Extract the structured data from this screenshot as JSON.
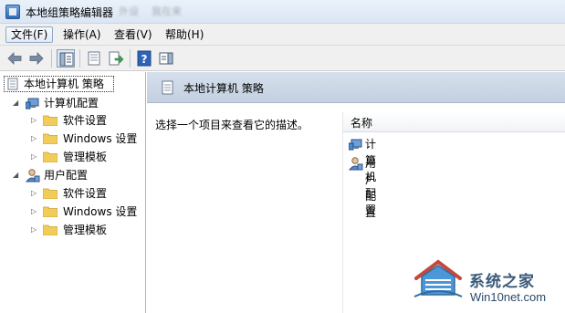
{
  "window": {
    "title": "本地组策略编辑器",
    "app_icon": "policy-editor-icon"
  },
  "background_tabs": [
    "外设",
    "我在来"
  ],
  "menubar": {
    "items": [
      {
        "label": "文件(F)",
        "active": true
      },
      {
        "label": "操作(A)"
      },
      {
        "label": "查看(V)"
      },
      {
        "label": "帮助(H)"
      }
    ]
  },
  "toolbar": {
    "buttons": [
      "back-arrow-icon",
      "forward-arrow-icon",
      "show-hide-console-tree-icon",
      "properties-icon",
      "export-list-icon",
      "help-icon",
      "action-pane-icon"
    ]
  },
  "tree": {
    "root": "本地计算机 策略",
    "computer": {
      "label": "计算机配置",
      "children": [
        "软件设置",
        "Windows 设置",
        "管理模板"
      ]
    },
    "user": {
      "label": "用户配置",
      "children": [
        "软件设置",
        "Windows 设置",
        "管理模板"
      ]
    }
  },
  "detail": {
    "header": "本地计算机 策略",
    "description": "选择一个项目来查看它的描述。",
    "column_name": "名称",
    "items": [
      "计算机配置",
      "用户配置"
    ]
  },
  "watermark": {
    "text": "系统之家",
    "url": "Win10net.com"
  },
  "colors": {
    "header_bg": "#c8d4e3",
    "selection_border": "#333333",
    "folder": "#f2cc58"
  }
}
